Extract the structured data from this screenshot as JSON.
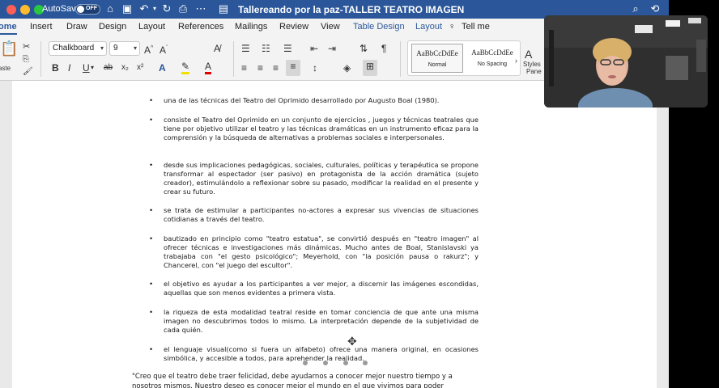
{
  "titlebar": {
    "autosave_label": "AutoSave",
    "autosave_state": "OFF",
    "document_title": "Tallereando por la paz-TALLER TEATRO IMAGEN"
  },
  "tabs": [
    "ome",
    "Insert",
    "Draw",
    "Design",
    "Layout",
    "References",
    "Mailings",
    "Review",
    "View",
    "Table Design",
    "Layout",
    "Tell me"
  ],
  "ribbon": {
    "paste_label": "aste",
    "font_name": "Chalkboard",
    "font_size": "9",
    "styles": [
      {
        "sample": "AaBbCcDdEe",
        "name": "Normal"
      },
      {
        "sample": "AaBbCcDdEe",
        "name": "No Spacing"
      }
    ],
    "styles_pane_label_1": "Styles",
    "styles_pane_label_2": "Pane"
  },
  "document": {
    "bullets": [
      "una de las técnicas del Teatro del Oprimido desarrollado por Augusto Boal (1980).",
      "consiste el Teatro del Oprimido en un conjunto de ejercicios , juegos y técnicas teatrales que tiene por objetivo utilizar el teatro y las técnicas dramáticas en un instrumento eficaz para la comprensión y la búsqueda de alternativas a problemas sociales e interpersonales.",
      "desde sus implicaciones pedagógicas, sociales, culturales, políticas y terapéutica se propone transformar al espectador (ser pasivo) en protagonista de la acción dramática (sujeto creador), estimulándolo a reflexionar sobre su pasado, modificar la realidad en el presente y crear su futuro.",
      "se trata de estimular a participantes no-actores a expresar sus vivencias de situaciones cotidianas a través del teatro.",
      "bautizado en principio como \"teatro estatua\", se convirtió después en \"teatro imagen\" al ofrecer técnicas e investigaciones más dinámicas. Mucho antes de Boal, Stanislavski ya trabajaba con \"el gesto psicológico\"; Meyerhold, con \"la posición pausa o rakurz\"; y Chancerel, con \"el juego del escultor\".",
      "el objetivo es ayudar a los participantes a ver mejor, a discernir las imágenes escondidas, aquellas que son menos evidentes a primera vista.",
      "la riqueza de esta modalidad teatral reside en tomar conciencia de que ante una misma imagen no descubrimos todos lo mismo. La interpretación depende de la subjetividad de cada quién.",
      "el lenguaje visual(como si fuera un alfabeto) ofrece una manera original, en ocasiones simbólica, y accesible a todos, para aprehender la realidad."
    ],
    "quote_line_1": "\"Creo que el teatro debe traer felicidad, debe ayudarnos a conocer mejor nuestro tiempo y a",
    "quote_line_2": "nosotros mismos. Nuestro deseo es conocer mejor el mundo en el que vivimos para poder"
  }
}
